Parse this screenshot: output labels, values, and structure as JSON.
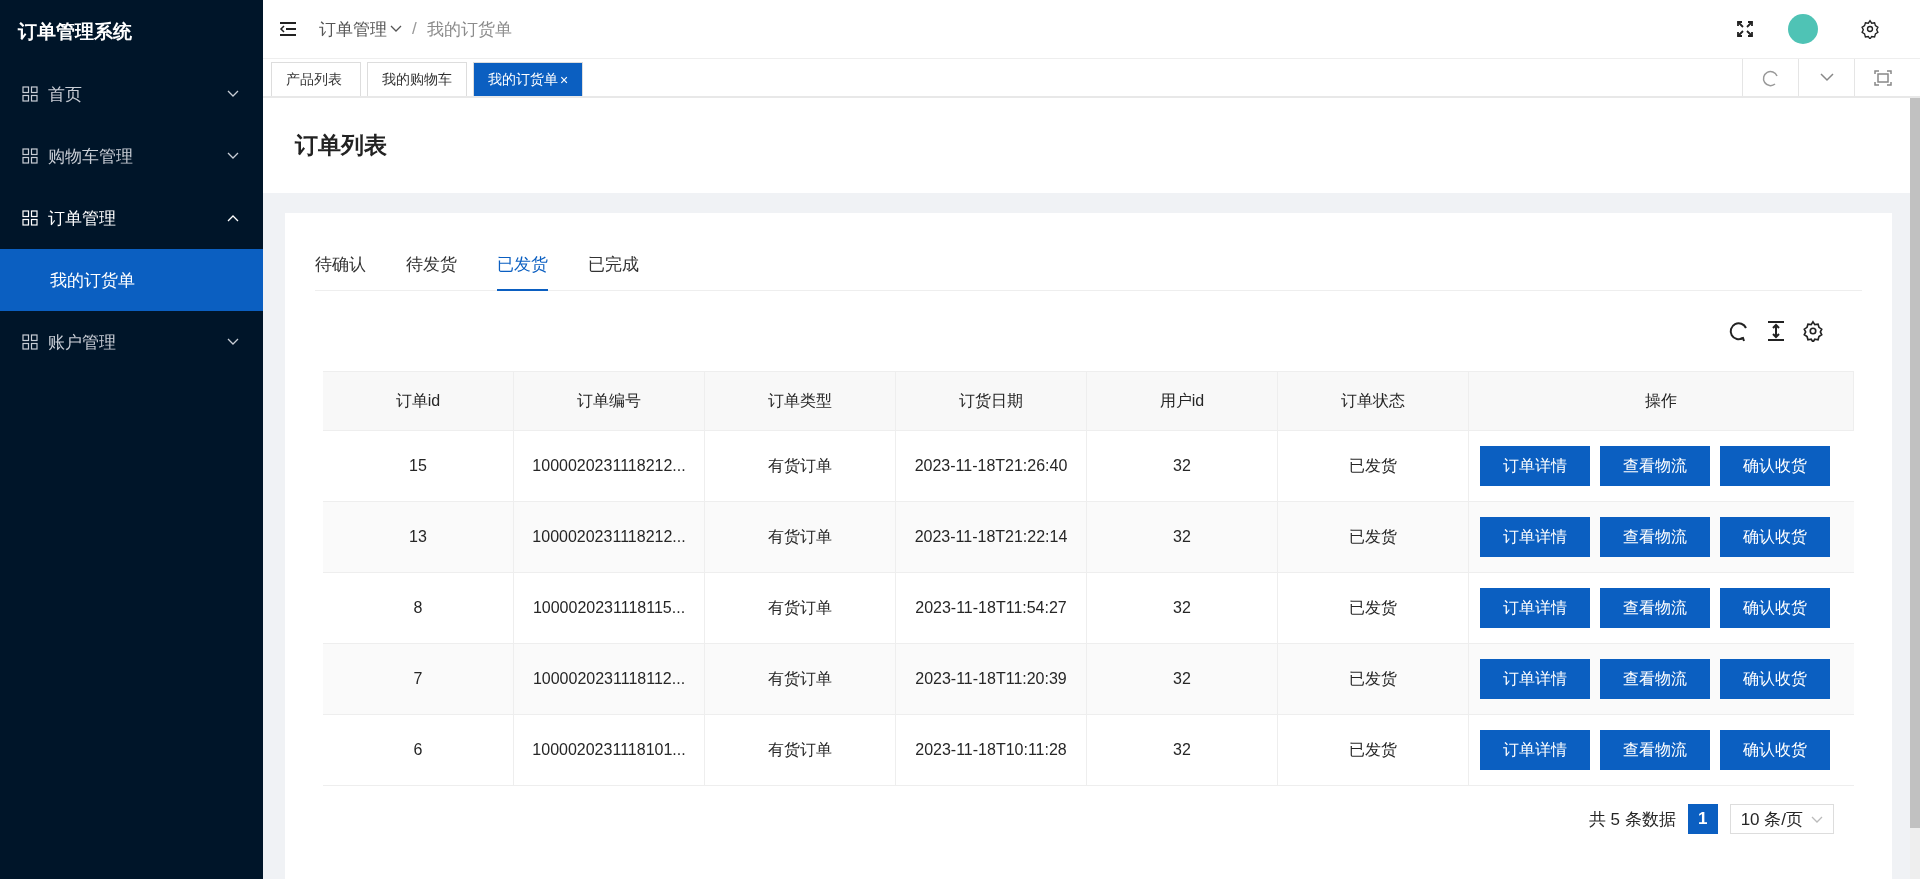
{
  "app_title": "订单管理系统",
  "sidebar": {
    "items": [
      {
        "label": "首页",
        "expanded": false
      },
      {
        "label": "购物车管理",
        "expanded": false
      },
      {
        "label": "订单管理",
        "expanded": true,
        "children": [
          {
            "label": "我的订货单",
            "selected": true
          }
        ]
      },
      {
        "label": "账户管理",
        "expanded": false
      }
    ]
  },
  "breadcrumb": {
    "separator": "/",
    "items": [
      {
        "label": "订单管理",
        "dropdown": true
      },
      {
        "label": "我的订货单",
        "dropdown": false
      }
    ]
  },
  "open_tabs": [
    {
      "label": "产品列表",
      "selected": false,
      "closable": false
    },
    {
      "label": "我的购物车",
      "selected": false,
      "closable": false
    },
    {
      "label": "我的订货单",
      "selected": true,
      "closable": true,
      "close": "×"
    }
  ],
  "page_title": "订单列表",
  "status_tabs": [
    {
      "label": "待确认",
      "selected": false
    },
    {
      "label": "待发货",
      "selected": false
    },
    {
      "label": "已发货",
      "selected": true
    },
    {
      "label": "已完成",
      "selected": false
    }
  ],
  "table": {
    "columns": [
      "订单id",
      "订单编号",
      "订单类型",
      "订货日期",
      "用户id",
      "订单状态",
      "操作"
    ],
    "rows": [
      {
        "cells": [
          "15",
          "1000020231118212...",
          "有货订单",
          "2023-11-18T21:26:40",
          "32",
          "已发货"
        ],
        "actions": [
          "订单详情",
          "查看物流",
          "确认收货"
        ]
      },
      {
        "cells": [
          "13",
          "1000020231118212...",
          "有货订单",
          "2023-11-18T21:22:14",
          "32",
          "已发货"
        ],
        "actions": [
          "订单详情",
          "查看物流",
          "确认收货"
        ]
      },
      {
        "cells": [
          "8",
          "1000020231118115...",
          "有货订单",
          "2023-11-18T11:54:27",
          "32",
          "已发货"
        ],
        "actions": [
          "订单详情",
          "查看物流",
          "确认收货"
        ]
      },
      {
        "cells": [
          "7",
          "1000020231118112...",
          "有货订单",
          "2023-11-18T11:20:39",
          "32",
          "已发货"
        ],
        "actions": [
          "订单详情",
          "查看物流",
          "确认收货"
        ]
      },
      {
        "cells": [
          "6",
          "1000020231118101...",
          "有货订单",
          "2023-11-18T10:11:28",
          "32",
          "已发货"
        ],
        "actions": [
          "订单详情",
          "查看物流",
          "确认收货"
        ]
      }
    ]
  },
  "pagination": {
    "total": "共 5 条数据",
    "pages": [
      {
        "label": "1",
        "selected": true
      }
    ],
    "page_size": "10 条/页"
  }
}
